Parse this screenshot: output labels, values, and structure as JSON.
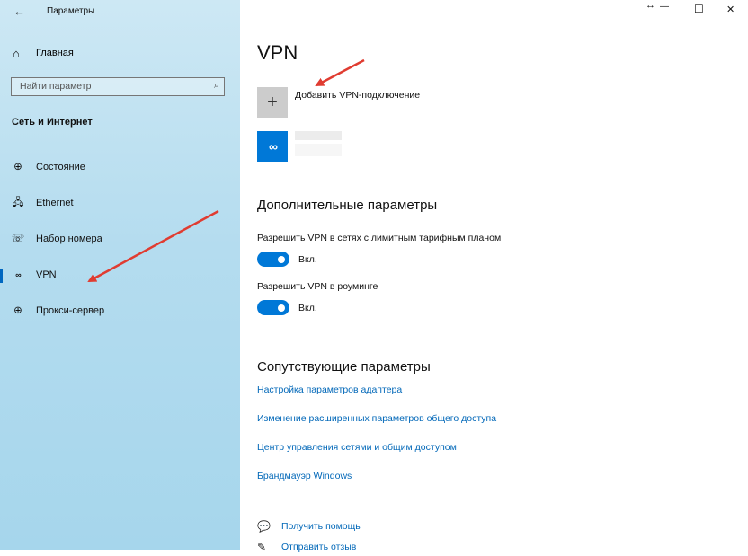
{
  "window": {
    "title": "Параметры",
    "controls": {
      "resize": "↔",
      "minimize": "—",
      "maximize": "☐",
      "close": "✕"
    }
  },
  "sidebar": {
    "home_label": "Главная",
    "search_placeholder": "Найти параметр",
    "section_title": "Сеть и Интернет",
    "items": [
      {
        "label": "Состояние",
        "icon": "globe-status-icon"
      },
      {
        "label": "Ethernet",
        "icon": "ethernet-icon"
      },
      {
        "label": "Набор номера",
        "icon": "dial-up-icon"
      },
      {
        "label": "VPN",
        "icon": "vpn-icon",
        "selected": true
      },
      {
        "label": "Прокси-сервер",
        "icon": "globe-icon"
      }
    ]
  },
  "main": {
    "title": "VPN",
    "add_vpn_label": "Добавить VPN-подключение",
    "advanced_title": "Дополнительные параметры",
    "options": [
      {
        "label": "Разрешить VPN в сетях с лимитным тарифным планом",
        "state_label": "Вкл.",
        "on": true
      },
      {
        "label": "Разрешить VPN в роуминге",
        "state_label": "Вкл.",
        "on": true
      }
    ],
    "related_title": "Сопутствующие параметры",
    "related_links": [
      "Настройка параметров адаптера",
      "Изменение расширенных параметров общего доступа",
      "Центр управления сетями и общим доступом",
      "Брандмауэр Windows"
    ],
    "help_link": "Получить помощь",
    "feedback_link": "Отправить отзыв"
  },
  "colors": {
    "accent": "#0078d7",
    "link": "#0067b8",
    "arrow": "#e03c31"
  }
}
